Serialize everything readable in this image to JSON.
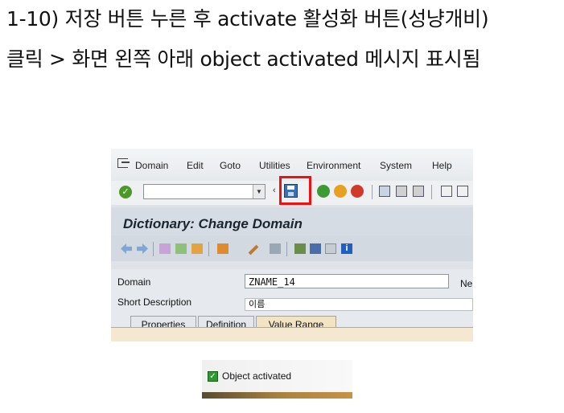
{
  "caption": {
    "line1": "1-10) 저장 버튼 누른 후 activate 활성화 버튼(성냥개비)",
    "line2": "클릭 > 화면 왼쪽 아래 object activated 메시지 표시됨"
  },
  "menu": [
    "Domain",
    "Edit",
    "Goto",
    "Utilities",
    "Environment",
    "System",
    "Help"
  ],
  "title": "Dictionary: Change Domain",
  "fields": {
    "domain_label": "Domain",
    "domain_value": "ZNAME_14",
    "short_desc_label": "Short Description",
    "short_desc_value": "이름",
    "next_label": "Ne"
  },
  "tabs": [
    "Properties",
    "Definition",
    "Value Range"
  ],
  "active_tab": "Value Range",
  "status": {
    "message": "Object activated"
  },
  "colors": {
    "highlight": "#ee1111",
    "title_bg": "#d6dce3",
    "success": "#2e9a2e"
  },
  "icons": [
    "exit-icon",
    "enter-check-icon",
    "save-icon",
    "back-icon",
    "exit-app-icon",
    "cancel-icon",
    "print-icon",
    "find-icon",
    "find-next-icon",
    "first-page-icon",
    "nav-back-icon",
    "nav-forward-icon",
    "display-change-icon",
    "other-object-icon",
    "check-icon",
    "activate-icon",
    "where-used-icon",
    "hierarchy-icon",
    "list-icon",
    "info-icon"
  ]
}
